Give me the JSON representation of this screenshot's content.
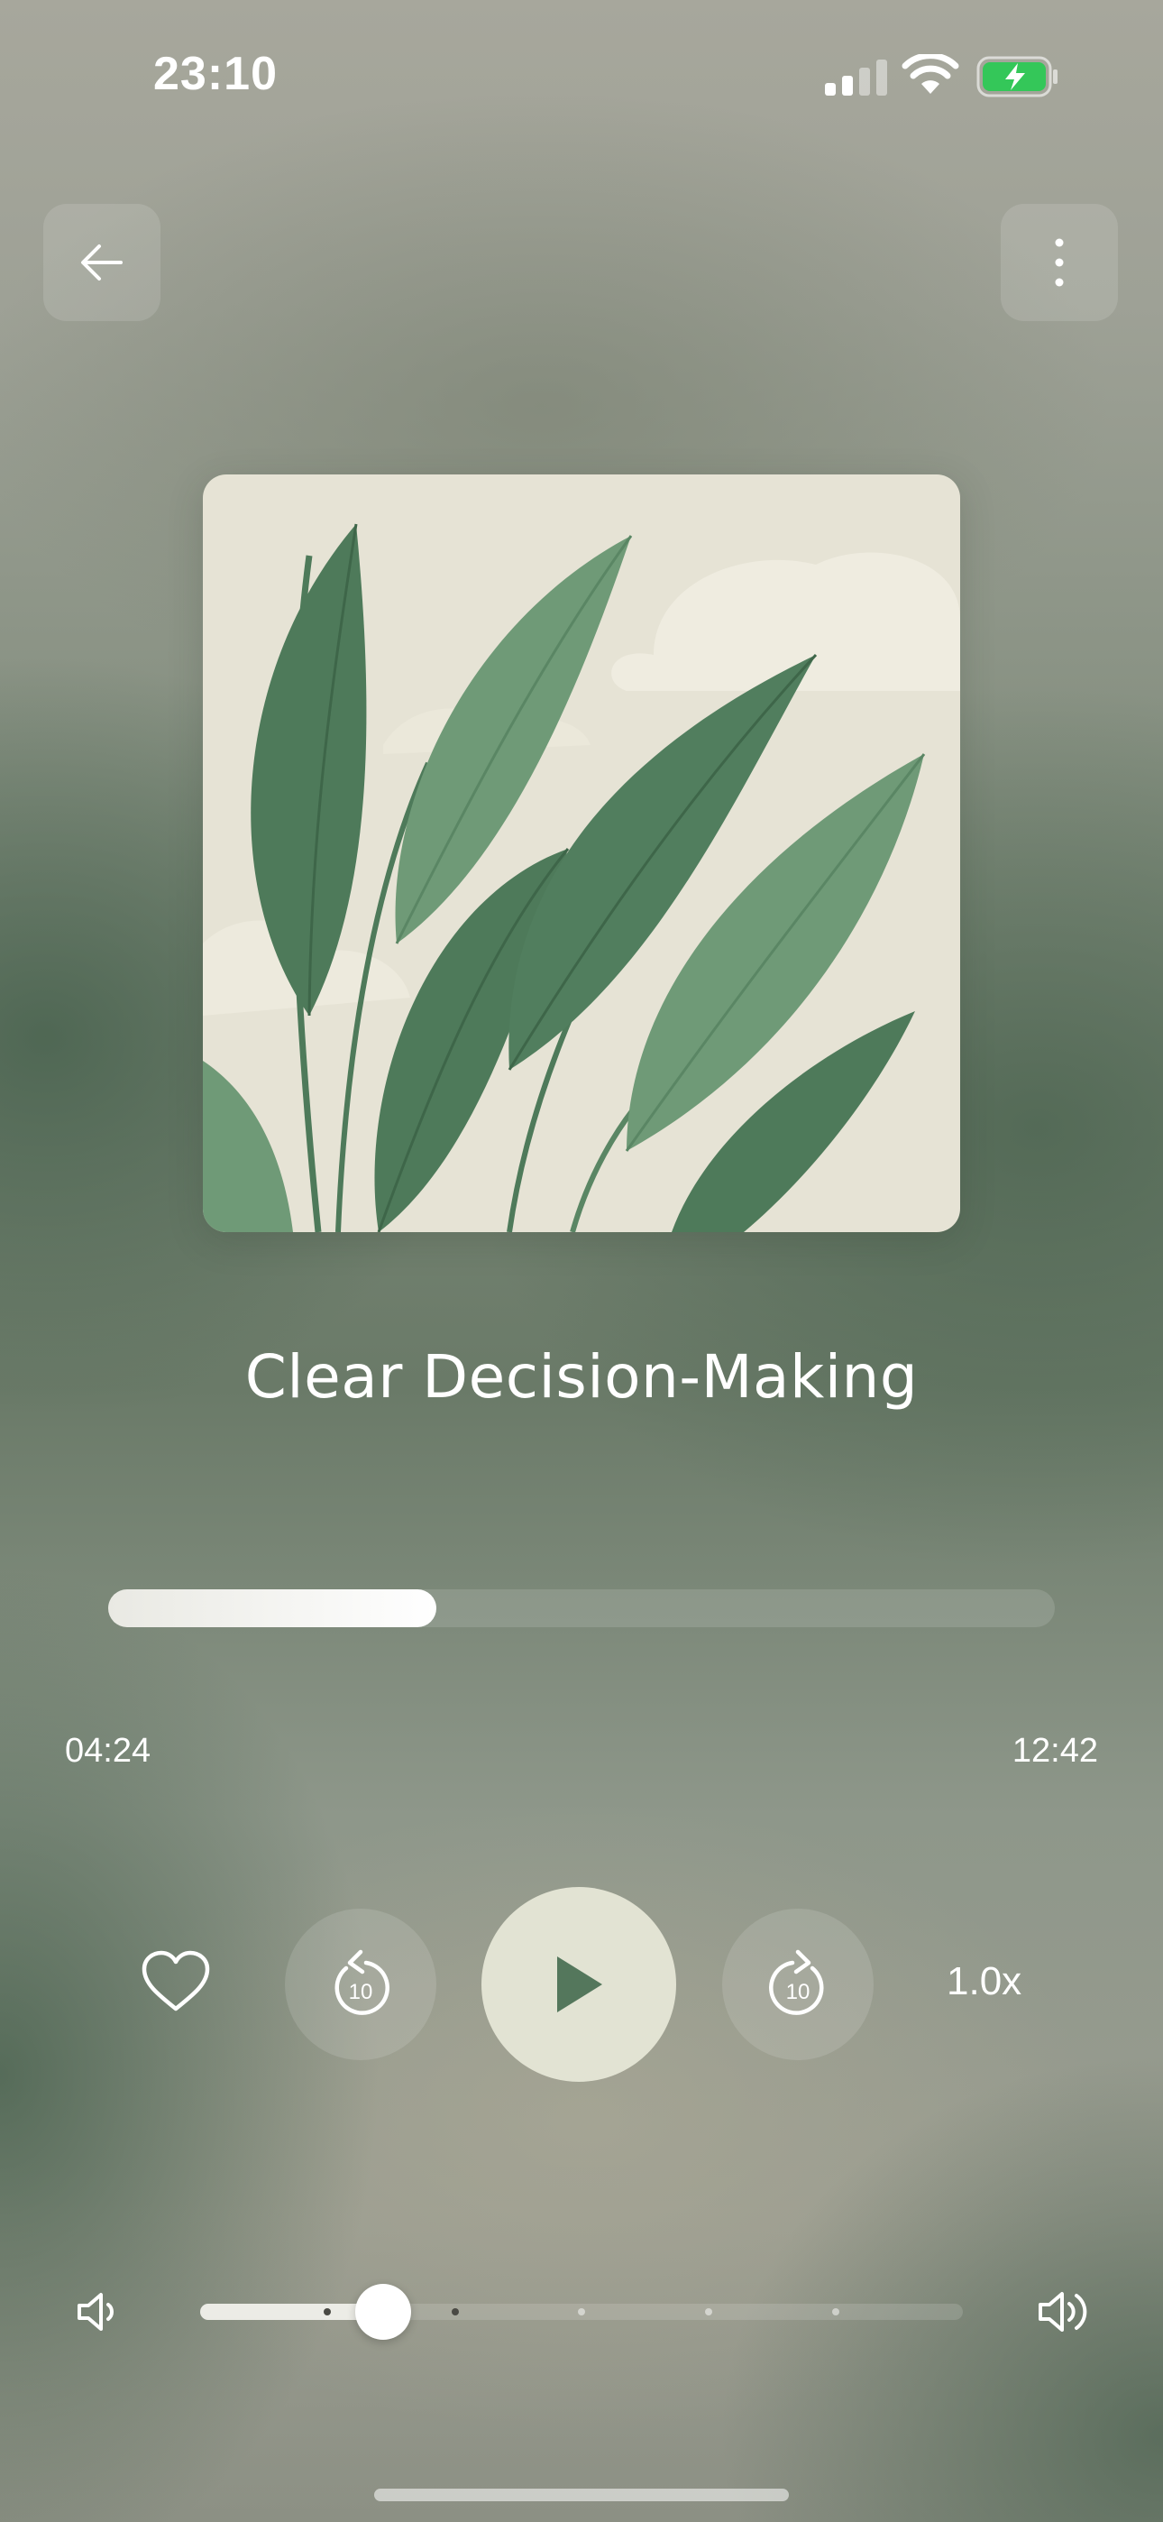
{
  "status_bar": {
    "time": "23:10",
    "signal_icon": "cellular-signal-icon",
    "wifi_icon": "wifi-icon",
    "battery_icon": "battery-charging-icon"
  },
  "header": {
    "back_icon": "arrow-left-icon",
    "more_icon": "more-vertical-icon"
  },
  "track": {
    "title": "Clear Decision-Making",
    "artwork": "leaves-illustration"
  },
  "progress": {
    "elapsed": "04:24",
    "total": "12:42",
    "fraction": 0.347
  },
  "controls": {
    "favorite_icon": "heart-icon",
    "skip_back_icon": "rewind-10-icon",
    "skip_back_seconds": "10",
    "play_icon": "play-icon",
    "skip_forward_icon": "forward-10-icon",
    "skip_forward_seconds": "10",
    "speed": "1.0x"
  },
  "volume": {
    "low_icon": "volume-low-icon",
    "high_icon": "volume-high-icon",
    "level": 0.24
  },
  "colors": {
    "play_button": "#e2e3d3",
    "leaf_dark": "#4e7a5a",
    "leaf_light": "#6f9a77",
    "artwork_bg": "#e6e3d5"
  }
}
